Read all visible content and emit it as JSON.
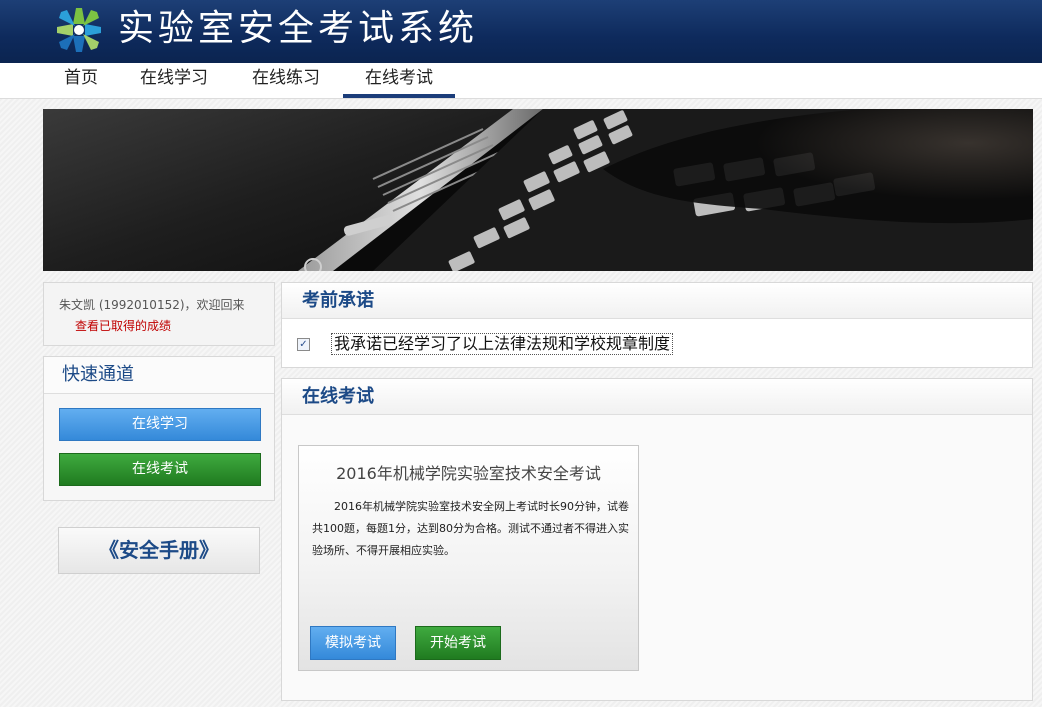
{
  "header": {
    "title": "实验室安全考试系统"
  },
  "nav": [
    {
      "label": "首页"
    },
    {
      "label": "在线学习"
    },
    {
      "label": "在线练习"
    },
    {
      "label": "在线考试",
      "active": true
    }
  ],
  "user": {
    "welcome": "朱文凯 (1992010152)，欢迎回来",
    "score_link": "查看已取得的成绩"
  },
  "quick": {
    "title": "快速通道",
    "study_btn": "在线学习",
    "exam_btn": "在线考试"
  },
  "manual": {
    "label": "《安全手册》"
  },
  "promise": {
    "title": "考前承诺",
    "checked": true,
    "text": "我承诺已经学习了以上法律法规和学校规章制度"
  },
  "exam": {
    "title": "在线考试",
    "card_title": "2016年机械学院实验室技术安全考试",
    "description": "2016年机械学院实验室技术安全网上考试时长90分钟，试卷共100题，每题1分，达到80分为合格。测试不通过者不得进入实验场所、不得开展相应实验。",
    "mock_btn": "模拟考试",
    "start_btn": "开始考试"
  },
  "colors": {
    "header_bg": "#0e2a5c",
    "accent_blue": "#3489d9",
    "accent_green": "#207b20",
    "title_blue": "#1c4a87",
    "link_red": "#c00000"
  }
}
